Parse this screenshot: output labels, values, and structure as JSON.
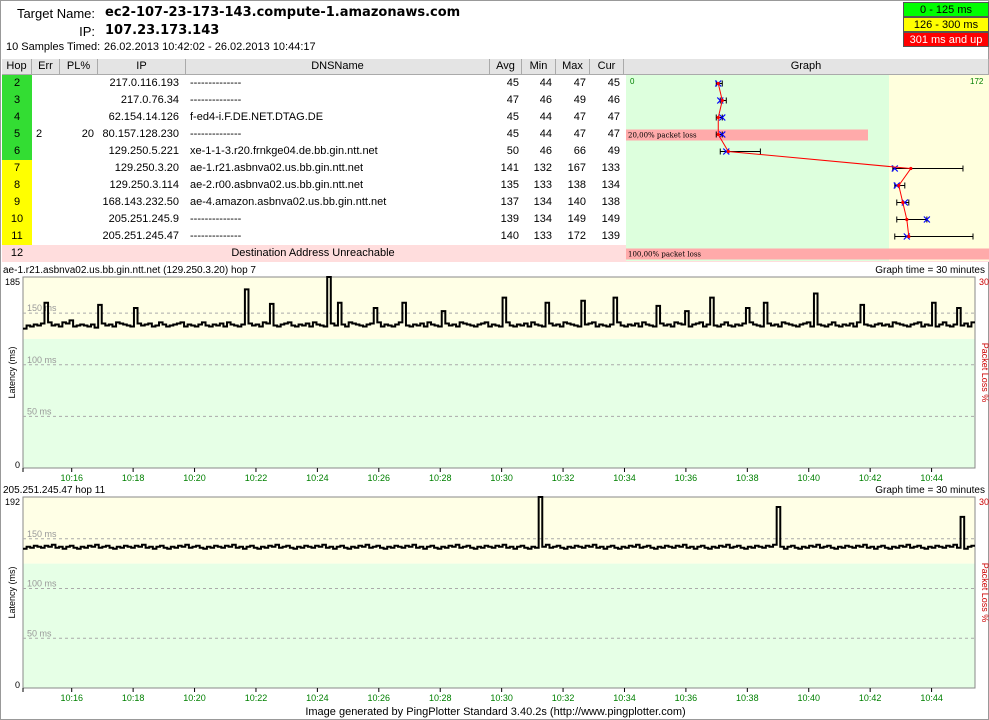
{
  "header": {
    "target_label": "Target Name:",
    "target_value": "ec2-107-23-173-143.compute-1.amazonaws.com",
    "ip_label": "IP:",
    "ip_value": "107.23.173.143",
    "samples_label": "10 Samples Timed:",
    "samples_value": "26.02.2013 10:42:02 - 26.02.2013 10:44:17"
  },
  "legend": [
    {
      "label": "0 - 125 ms",
      "color": "#00ff00",
      "text_color": "#000000"
    },
    {
      "label": "126 - 300 ms",
      "color": "#ffff00",
      "text_color": "#000000"
    },
    {
      "label": "301 ms and up",
      "color": "#ff0000",
      "text_color": "#ffffff"
    }
  ],
  "table": {
    "columns": [
      "Hop",
      "Err",
      "PL%",
      "IP",
      "DNSName",
      "Avg",
      "Min",
      "Max",
      "Cur",
      "Graph"
    ],
    "graph_min_label": "0",
    "graph_max_label": "172",
    "rows": [
      {
        "hop": "2",
        "err": "",
        "pl": "",
        "ip": "217.0.116.193",
        "dns": "--------------",
        "avg": "45",
        "min": "44",
        "max": "47",
        "cur": "45",
        "color": "green"
      },
      {
        "hop": "3",
        "err": "",
        "pl": "",
        "ip": "217.0.76.34",
        "dns": "--------------",
        "avg": "47",
        "min": "46",
        "max": "49",
        "cur": "46",
        "color": "green"
      },
      {
        "hop": "4",
        "err": "",
        "pl": "",
        "ip": "62.154.14.126",
        "dns": "f-ed4-i.F.DE.NET.DTAG.DE",
        "avg": "45",
        "min": "44",
        "max": "47",
        "cur": "47",
        "color": "green"
      },
      {
        "hop": "5",
        "err": "2",
        "pl": "20",
        "ip": "80.157.128.230",
        "dns": "--------------",
        "avg": "45",
        "min": "44",
        "max": "47",
        "cur": "47",
        "color": "green",
        "loss_label": "20,00% packet loss"
      },
      {
        "hop": "6",
        "err": "",
        "pl": "",
        "ip": "129.250.5.221",
        "dns": "xe-1-1-3.r20.frnkge04.de.bb.gin.ntt.net",
        "avg": "50",
        "min": "46",
        "max": "66",
        "cur": "49",
        "color": "green"
      },
      {
        "hop": "7",
        "err": "",
        "pl": "",
        "ip": "129.250.3.20",
        "dns": "ae-1.r21.asbnva02.us.bb.gin.ntt.net",
        "avg": "141",
        "min": "132",
        "max": "167",
        "cur": "133",
        "color": "yellow"
      },
      {
        "hop": "8",
        "err": "",
        "pl": "",
        "ip": "129.250.3.114",
        "dns": "ae-2.r00.asbnva02.us.bb.gin.ntt.net",
        "avg": "135",
        "min": "133",
        "max": "138",
        "cur": "134",
        "color": "yellow"
      },
      {
        "hop": "9",
        "err": "",
        "pl": "",
        "ip": "168.143.232.50",
        "dns": "ae-4.amazon.asbnva02.us.bb.gin.ntt.net",
        "avg": "137",
        "min": "134",
        "max": "140",
        "cur": "138",
        "color": "yellow"
      },
      {
        "hop": "10",
        "err": "",
        "pl": "",
        "ip": "205.251.245.9",
        "dns": "--------------",
        "avg": "139",
        "min": "134",
        "max": "149",
        "cur": "149",
        "color": "yellow"
      },
      {
        "hop": "11",
        "err": "",
        "pl": "",
        "ip": "205.251.245.47",
        "dns": "--------------",
        "avg": "140",
        "min": "133",
        "max": "172",
        "cur": "139",
        "color": "yellow"
      }
    ],
    "unreachable": {
      "hop": "12",
      "text": "Destination Address Unreachable",
      "loss_label": "100,00% packet loss"
    }
  },
  "chart_data": [
    {
      "type": "line",
      "title": "ae-1.r21.asbnva02.us.bb.gin.ntt.net (129.250.3.20) hop 7",
      "graph_time": "Graph time = 30 minutes",
      "ylabel": "Latency (ms)",
      "y2label": "Packet Loss %",
      "ymax_label": "185",
      "ymin_label": "0",
      "y2max_label": "30",
      "gridlines": [
        "150 ms",
        "100 ms",
        "50 ms"
      ],
      "ylim": [
        0,
        185
      ],
      "x_ticks": [
        "10:16",
        "10:18",
        "10:20",
        "10:22",
        "10:24",
        "10:26",
        "10:28",
        "10:30",
        "10:32",
        "10:34",
        "10:36",
        "10:38",
        "10:40",
        "10:42",
        "10:44"
      ],
      "values": [
        135,
        138,
        137,
        139,
        138,
        140,
        160,
        141,
        138,
        139,
        137,
        141,
        140,
        143,
        137,
        138,
        139,
        138,
        137,
        139,
        136,
        158,
        140,
        138,
        139,
        137,
        141,
        140,
        139,
        138,
        137,
        155,
        140,
        138,
        139,
        140,
        137,
        138,
        141,
        139,
        137,
        138,
        139,
        140,
        141,
        137,
        139,
        138,
        137,
        139,
        141,
        138,
        137,
        139,
        138,
        140,
        137,
        141,
        139,
        138,
        137,
        139,
        173,
        140,
        138,
        139,
        137,
        141,
        140,
        159,
        138,
        137,
        139,
        140,
        141,
        138,
        137,
        139,
        138,
        140,
        137,
        141,
        139,
        138,
        137,
        185,
        140,
        138,
        160,
        139,
        137,
        141,
        140,
        139,
        138,
        137,
        139,
        140,
        155,
        141,
        137,
        139,
        138,
        137,
        139,
        141,
        160,
        138,
        137,
        139,
        138,
        140,
        137,
        141,
        139,
        138,
        137,
        152,
        140,
        138,
        139,
        137,
        141,
        140,
        139,
        138,
        137,
        139,
        140,
        141,
        137,
        139,
        138,
        137,
        165,
        141,
        138,
        137,
        139,
        138,
        140,
        137,
        141,
        139,
        138,
        137,
        160,
        140,
        138,
        139,
        137,
        141,
        140,
        139,
        138,
        137,
        162,
        139,
        140,
        141,
        137,
        139,
        138,
        137,
        139,
        165,
        141,
        138,
        137,
        139,
        138,
        140,
        137,
        141,
        139,
        138,
        137,
        157,
        140,
        138,
        139,
        137,
        141,
        140,
        139,
        152,
        137,
        139,
        140,
        141,
        137,
        139,
        165,
        138,
        137,
        139,
        141,
        138,
        137,
        139,
        138,
        140,
        155,
        141,
        139,
        138,
        137,
        160,
        140,
        138,
        139,
        137,
        141,
        140,
        139,
        138,
        137,
        139,
        140,
        141,
        137,
        169,
        139,
        138,
        137,
        139,
        141,
        138,
        137,
        139,
        138,
        140,
        137,
        141,
        158,
        139,
        138,
        137,
        139,
        140,
        138,
        139,
        137,
        141,
        140,
        139,
        138,
        137,
        139,
        140,
        141,
        137,
        139,
        138,
        160,
        137,
        139,
        141,
        138,
        137,
        139,
        155,
        138,
        140,
        137,
        141
      ]
    },
    {
      "type": "line",
      "title": "205.251.245.47 hop 11",
      "graph_time": "Graph time = 30 minutes",
      "ylabel": "Latency (ms)",
      "y2label": "Packet Loss %",
      "ymax_label": "192",
      "ymin_label": "0",
      "y2max_label": "30",
      "gridlines": [
        "150 ms",
        "100 ms",
        "50 ms"
      ],
      "ylim": [
        0,
        192
      ],
      "x_ticks": [
        "10:16",
        "10:18",
        "10:20",
        "10:22",
        "10:24",
        "10:26",
        "10:28",
        "10:30",
        "10:32",
        "10:34",
        "10:36",
        "10:38",
        "10:40",
        "10:42",
        "10:44"
      ],
      "values": [
        140,
        142,
        141,
        143,
        142,
        141,
        143,
        142,
        144,
        141,
        142,
        140,
        142,
        143,
        141,
        140,
        142,
        141,
        143,
        142,
        144,
        141,
        142,
        143,
        141,
        140,
        142,
        141,
        143,
        142,
        141,
        143,
        142,
        144,
        141,
        142,
        140,
        142,
        143,
        141,
        140,
        142,
        141,
        143,
        142,
        144,
        141,
        142,
        143,
        141,
        140,
        142,
        141,
        143,
        142,
        141,
        143,
        142,
        144,
        141,
        142,
        140,
        142,
        143,
        141,
        140,
        142,
        141,
        143,
        142,
        144,
        141,
        142,
        143,
        141,
        140,
        142,
        141,
        143,
        142,
        141,
        143,
        142,
        144,
        141,
        142,
        140,
        142,
        143,
        141,
        140,
        142,
        141,
        143,
        142,
        144,
        141,
        142,
        143,
        141,
        140,
        142,
        141,
        143,
        142,
        141,
        143,
        142,
        144,
        141,
        142,
        140,
        142,
        143,
        141,
        140,
        142,
        141,
        143,
        142,
        144,
        141,
        142,
        143,
        141,
        140,
        142,
        141,
        143,
        142,
        141,
        143,
        142,
        144,
        141,
        142,
        140,
        142,
        143,
        141,
        140,
        142,
        141,
        192,
        142,
        144,
        141,
        142,
        143,
        141,
        140,
        142,
        141,
        143,
        142,
        141,
        143,
        142,
        144,
        141,
        142,
        140,
        142,
        143,
        141,
        140,
        142,
        141,
        143,
        142,
        144,
        141,
        142,
        143,
        141,
        140,
        142,
        141,
        143,
        142,
        141,
        143,
        142,
        144,
        141,
        142,
        140,
        142,
        143,
        141,
        140,
        142,
        141,
        143,
        142,
        144,
        141,
        142,
        143,
        141,
        140,
        142,
        141,
        143,
        142,
        141,
        143,
        142,
        144,
        182,
        142,
        140,
        142,
        143,
        141,
        140,
        142,
        141,
        143,
        142,
        144,
        141,
        142,
        143,
        141,
        140,
        142,
        141,
        143,
        142,
        141,
        143,
        142,
        144,
        141,
        142,
        140,
        142,
        143,
        141,
        140,
        142,
        141,
        143,
        142,
        144,
        141,
        142,
        143,
        141,
        140,
        142,
        141,
        143,
        142,
        141,
        143,
        142,
        144,
        141,
        172,
        140,
        142,
        143
      ]
    }
  ],
  "footer": "Image generated by PingPlotter Standard 3.40.2s (http://www.pingplotter.com)"
}
